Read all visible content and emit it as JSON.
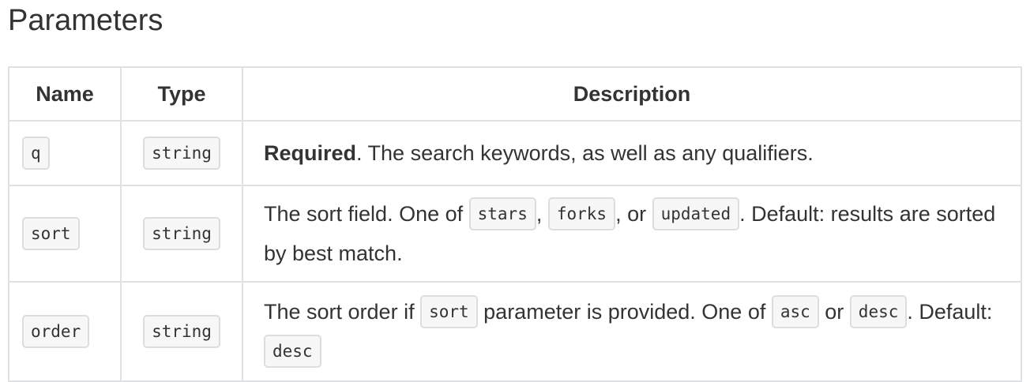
{
  "title": "Parameters",
  "columns": {
    "name": "Name",
    "type": "Type",
    "description": "Description"
  },
  "rows": [
    {
      "name": "q",
      "type": "string",
      "desc": {
        "strong": "Required",
        "text": ". The search keywords, as well as any qualifiers."
      }
    },
    {
      "name": "sort",
      "type": "string",
      "desc": {
        "t1": "The sort field. One of ",
        "c1": "stars",
        "t2": ", ",
        "c2": "forks",
        "t3": ", or ",
        "c3": "updated",
        "t4": ". Default: results are sorted by best match."
      }
    },
    {
      "name": "order",
      "type": "string",
      "desc": {
        "t1": "The sort order if ",
        "c1": "sort",
        "t2": " parameter is provided. One of ",
        "c2": "asc",
        "t3": " or ",
        "c3": "desc",
        "t4": ". Default: ",
        "c4": "desc"
      }
    }
  ]
}
